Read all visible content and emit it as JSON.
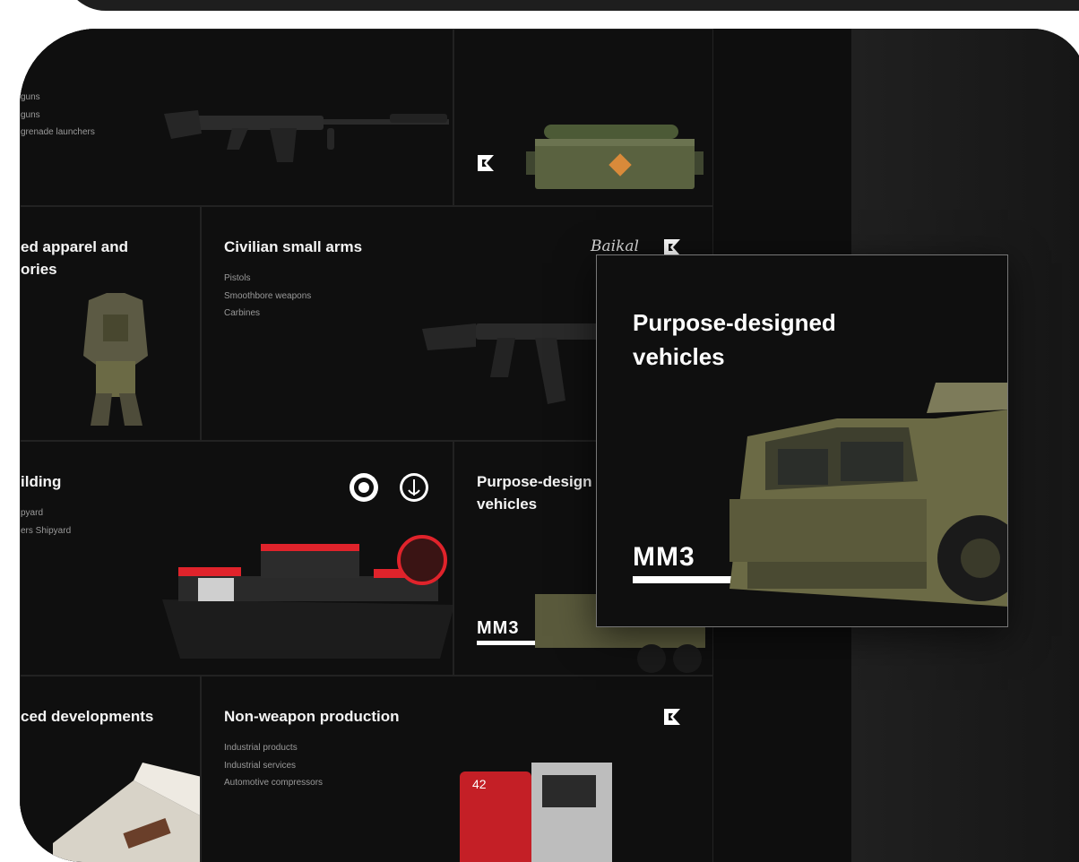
{
  "cards": {
    "guns": {
      "lines": [
        "guns",
        "",
        "guns",
        "grenade launchers"
      ]
    },
    "apparel": {
      "title_l1": "ed apparel and",
      "title_l2": "ories"
    },
    "civilian": {
      "title": "Civilian small arms",
      "items": [
        "Pistols",
        "Smoothbore weapons",
        "Carbines"
      ],
      "brand": "Baikal"
    },
    "shipbuilding": {
      "title": "ilding",
      "items": [
        "pyard",
        "ers Shipyard"
      ]
    },
    "vehicles": {
      "title_l1": "Purpose-design",
      "title_l2": "vehicles",
      "brand": "MM3"
    },
    "advanced": {
      "title": "ced developments"
    },
    "nonweapon": {
      "title": "Non-weapon production",
      "items": [
        "Industrial products",
        "Industrial services",
        "Automotive compressors"
      ],
      "badge": "42"
    }
  },
  "overlay": {
    "title_l1": "Purpose-designed",
    "title_l2": "vehicles",
    "brand": "MM3"
  },
  "colors": {
    "background": "#0e0e0e",
    "text": "#f4f4f4",
    "muted": "#9a9a9a",
    "accent_red": "#e0232b",
    "military_green": "#6b6a45"
  },
  "icons": [
    "kalashnikov-logo-icon",
    "shipyard-emblem-icon",
    "anchor-emblem-icon"
  ]
}
